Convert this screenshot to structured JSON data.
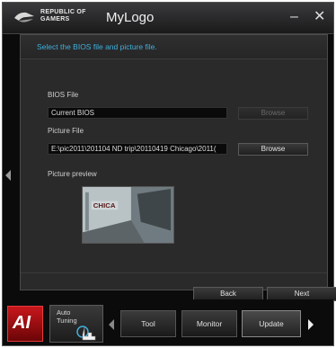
{
  "window": {
    "brand_line1": "REPUBLIC OF",
    "brand_line2": "GAMERS",
    "title": "MyLogo",
    "minimize_glyph": "–",
    "close_glyph": "✕"
  },
  "main": {
    "instruction": "Select the BIOS file and picture file.",
    "bios_file_label": "BIOS File",
    "bios_file_value": "Current BIOS",
    "bios_browse_label": "Browse",
    "picture_file_label": "Picture File",
    "picture_file_value": "E:\\pic2011\\201104 ND trip\\20110419 Chicago\\2011(",
    "picture_browse_label": "Browse",
    "preview_label": "Picture preview",
    "back_label": "Back",
    "next_label": "Next"
  },
  "bottom": {
    "rog_logo_text": "AI",
    "auto_tuning_line1": "Auto",
    "auto_tuning_line2": "Tuning",
    "tabs": [
      {
        "label": "Tool"
      },
      {
        "label": "Monitor"
      },
      {
        "label": "Update"
      }
    ]
  },
  "icons": {
    "eye_logo": "rog-eye-icon",
    "auto_tuning": "hand-cursor-icon",
    "left_arrow": "chevron-left-icon",
    "right_arrow": "chevron-right-icon"
  },
  "colors": {
    "accent_text": "#3fb0dc",
    "rog_red": "#c7171c",
    "window_bg": "#0b0b0c",
    "panel_bg": "#2a2a2b"
  }
}
